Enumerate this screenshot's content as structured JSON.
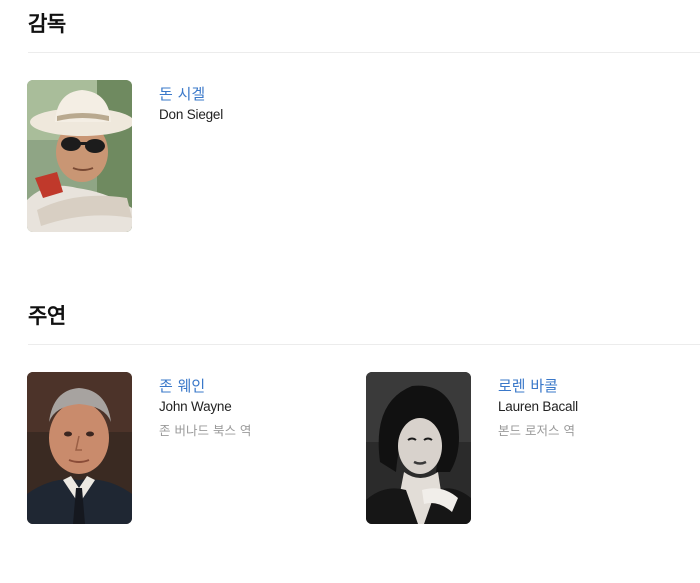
{
  "director_section": {
    "title": "감독",
    "people": [
      {
        "name_ko": "돈 시겔",
        "name_en": "Don Siegel"
      }
    ]
  },
  "cast_section": {
    "title": "주연",
    "people": [
      {
        "name_ko": "존 웨인",
        "name_en": "John Wayne",
        "role": "존 버나드 북스 역"
      },
      {
        "name_ko": "로렌 바콜",
        "name_en": "Lauren Bacall",
        "role": "본드 로저스 역"
      }
    ]
  },
  "colors": {
    "link": "#3a78c9",
    "heading": "#111111",
    "role_text": "#9a9a9a",
    "divider": "#ececec"
  }
}
